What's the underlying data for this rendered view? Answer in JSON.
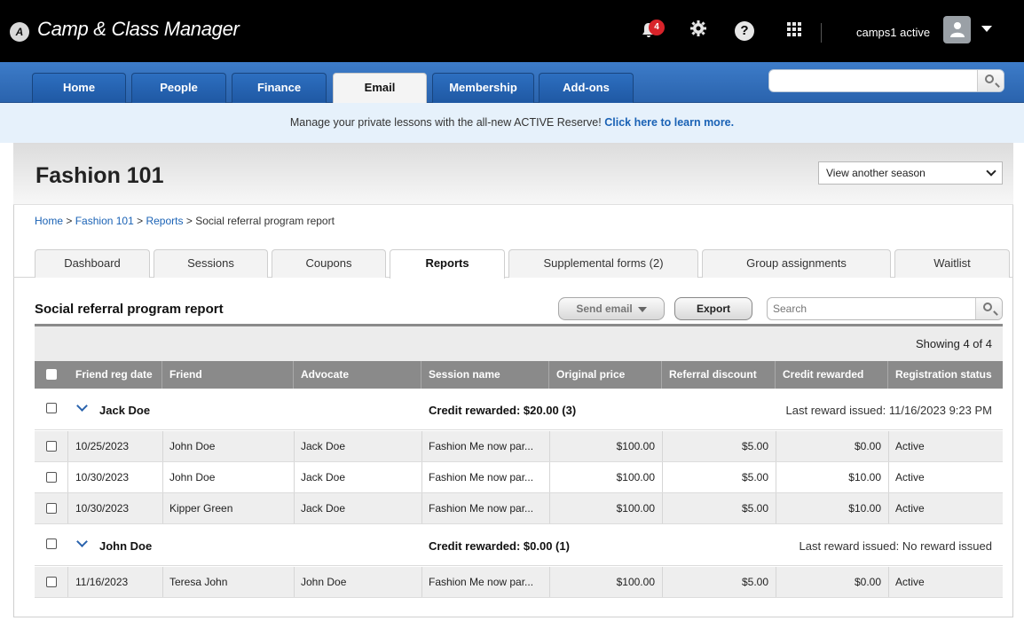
{
  "app": {
    "title": "Camp & Class Manager",
    "logo": "A",
    "notifications_count": "4",
    "user_name": "camps1 active"
  },
  "nav": {
    "tabs": [
      {
        "label": "Home"
      },
      {
        "label": "People"
      },
      {
        "label": "Finance"
      },
      {
        "label": "Email"
      },
      {
        "label": "Membership"
      },
      {
        "label": "Add-ons"
      }
    ],
    "active": "Email",
    "search_value": ""
  },
  "promo": {
    "text": "Manage your private lessons with the all-new ACTIVE Reserve!",
    "link": "Click here to learn more."
  },
  "season": {
    "title": "Fashion 101",
    "selector": "View another season"
  },
  "breadcrumb": {
    "home": "Home",
    "season": "Fashion 101",
    "reports": "Reports",
    "current": "Social referral program report",
    "sep": ">"
  },
  "subtabs": [
    {
      "label": "Dashboard"
    },
    {
      "label": "Sessions"
    },
    {
      "label": "Coupons"
    },
    {
      "label": "Reports"
    },
    {
      "label": "Supplemental forms (2)"
    },
    {
      "label": "Group assignments"
    },
    {
      "label": "Waitlist"
    }
  ],
  "report": {
    "title": "Social referral program report",
    "send_email": "Send email",
    "export": "Export",
    "search_placeholder": "Search",
    "showing": "Showing 4 of 4"
  },
  "table": {
    "columns": [
      "Friend reg date",
      "Friend",
      "Advocate",
      "Session name",
      "Original price",
      "Referral discount",
      "Credit rewarded",
      "Registration status"
    ],
    "groups": [
      {
        "name": "Jack Doe",
        "credit": "Credit rewarded: $20.00 (3)",
        "last": "Last reward issued: 11/16/2023 9:23 PM",
        "rows": [
          {
            "date": "10/25/2023",
            "friend": "John Doe",
            "advocate": "Jack Doe",
            "session": "Fashion Me now par...",
            "price": "$100.00",
            "discount": "$5.00",
            "credit": "$0.00",
            "status": "Active"
          },
          {
            "date": "10/30/2023",
            "friend": "John Doe",
            "advocate": "Jack Doe",
            "session": "Fashion Me now par...",
            "price": "$100.00",
            "discount": "$5.00",
            "credit": "$10.00",
            "status": "Active"
          },
          {
            "date": "10/30/2023",
            "friend": "Kipper Green",
            "advocate": "Jack Doe",
            "session": "Fashion Me now par...",
            "price": "$100.00",
            "discount": "$5.00",
            "credit": "$10.00",
            "status": "Active"
          }
        ]
      },
      {
        "name": "John Doe",
        "credit": "Credit rewarded: $0.00 (1)",
        "last": "Last reward issued: No reward issued",
        "rows": [
          {
            "date": "11/16/2023",
            "friend": "Teresa John",
            "advocate": "John Doe",
            "session": "Fashion Me now par...",
            "price": "$100.00",
            "discount": "$5.00",
            "credit": "$0.00",
            "status": "Active"
          }
        ]
      }
    ]
  },
  "colors": {
    "nav_blue": "#2a63ad",
    "link_blue": "#1a62b5",
    "header_gray": "#8a8a8a",
    "badge_red": "#d8232a"
  },
  "icons": [
    "logo-icon",
    "bell-icon",
    "gear-icon",
    "help-icon",
    "apps-grid-icon",
    "avatar-icon",
    "chevron-down-icon",
    "search-icon",
    "expand-chevron-icon",
    "checkbox-icon"
  ]
}
